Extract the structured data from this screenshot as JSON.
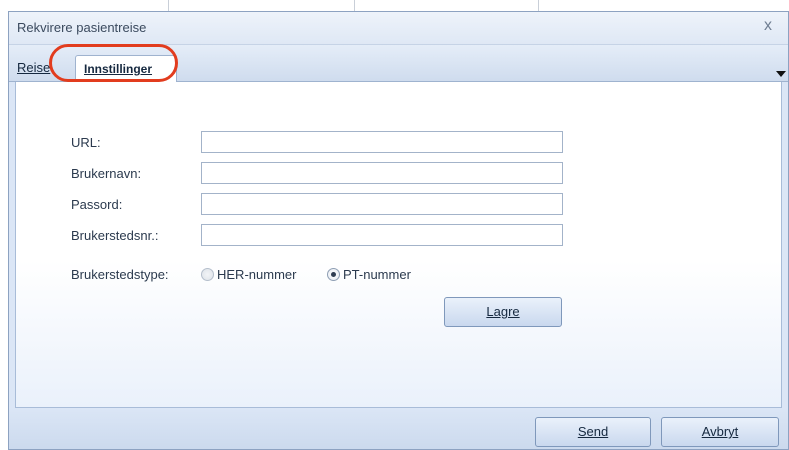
{
  "window": {
    "title": "Rekvirere pasientreise",
    "close_glyph": "x"
  },
  "tabs": [
    {
      "label": "Reise",
      "active": false
    },
    {
      "label": "Innstillinger",
      "active": true
    }
  ],
  "form": {
    "url_label": "URL:",
    "url_value": "",
    "username_label": "Brukernavn:",
    "username_value": "",
    "password_label": "Passord:",
    "password_value": "",
    "site_number_label": "Brukerstedsnr.:",
    "site_number_value": "",
    "site_type_label": "Brukerstedstype:",
    "site_type_options": [
      {
        "label": "HER-nummer",
        "selected": false,
        "enabled": false
      },
      {
        "label": "PT-nummer",
        "selected": true,
        "enabled": true
      }
    ],
    "save_label": "Lagre"
  },
  "footer": {
    "send_label": "Send",
    "cancel_label": "Avbryt"
  },
  "colors": {
    "highlight_ring": "#e23c1e",
    "dialog_border": "#8da2c1",
    "button_border": "#7f98bb"
  },
  "icons": {
    "close": "close-icon",
    "tab_menu": "chevron-down-icon"
  }
}
